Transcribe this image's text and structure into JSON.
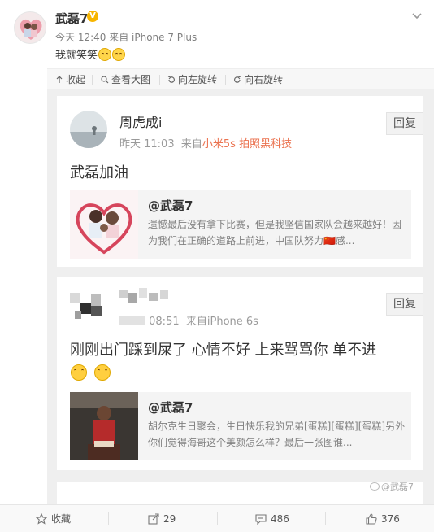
{
  "post": {
    "author": "武磊7",
    "verified_badge": "V",
    "meta": "今天 12:40 来自 iPhone 7 Plus",
    "text": "我就笑笑"
  },
  "media_toolbar": {
    "collapse": "收起",
    "view_large": "查看大图",
    "rotate_left": "向左旋转",
    "rotate_right": "向右旋转"
  },
  "comments": [
    {
      "name": "周虎成i",
      "time": "昨天 11:03",
      "source_prefix": "来自",
      "device": "小米5s 拍照黑科技",
      "text": "武磊加油",
      "reply": "回复",
      "quote": {
        "author": "@武磊7",
        "text": "遗憾最后没有拿下比赛，但是我坚信国家队会越来越好！因为我们在正确的道路上前进，中国队努力🇨🇳感..."
      }
    },
    {
      "name": "",
      "time": "08:51",
      "source_prefix": "来自",
      "device": "iPhone 6s",
      "text": "刚刚出门踩到屎了 心情不好 上来骂骂你 单不进",
      "reply": "回复",
      "quote": {
        "author": "@武磊7",
        "text": "胡尔克生日聚会，生日快乐我的兄弟[蛋糕][蛋糕][蛋糕]另外你们觉得海哥这个美颜怎么样？最后一张图谁..."
      }
    }
  ],
  "watermark": "@武磊7",
  "bottom_bar": {
    "favorite": "收藏",
    "reposts": "29",
    "comments": "486",
    "likes": "376"
  },
  "colors": {
    "accent_orange": "#eb7350",
    "verified": "#f7b500",
    "screenshot_bg": "#efefef"
  },
  "icons": [
    "chevron-down-icon",
    "collapse-arrow-icon",
    "search-icon",
    "rotate-left-icon",
    "rotate-right-icon",
    "star-icon",
    "repost-icon",
    "comment-icon",
    "thumbs-up-icon",
    "weibo-logo-icon"
  ]
}
